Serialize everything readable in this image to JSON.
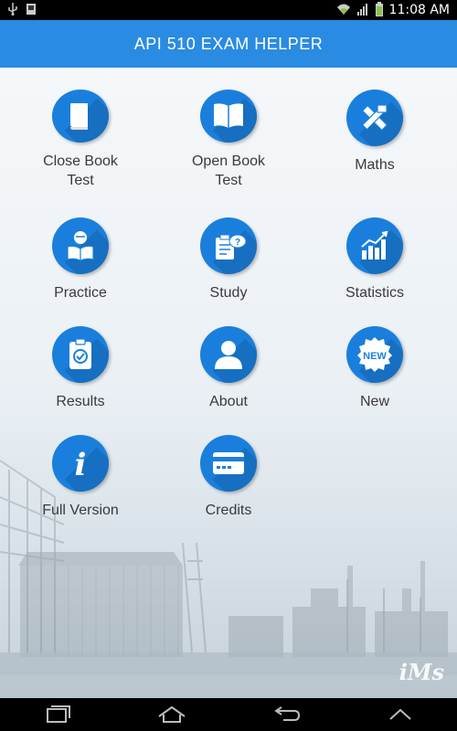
{
  "status_bar": {
    "time": "11:08 AM",
    "icons": [
      "usb-icon",
      "screenshot-icon",
      "wifi-icon",
      "signal-icon",
      "battery-icon"
    ]
  },
  "header": {
    "title": "API 510 EXAM HELPER"
  },
  "menu": {
    "items": [
      {
        "label": "Close Book\nTest",
        "icon": "closed-book-icon"
      },
      {
        "label": "Open Book\nTest",
        "icon": "open-book-icon"
      },
      {
        "label": "Maths",
        "icon": "pencil-ruler-icon"
      },
      {
        "label": "Practice",
        "icon": "reading-person-icon"
      },
      {
        "label": "Study",
        "icon": "study-clipboard-icon"
      },
      {
        "label": "Statistics",
        "icon": "bar-chart-icon"
      },
      {
        "label": "Results",
        "icon": "checklist-icon"
      },
      {
        "label": "About",
        "icon": "person-icon"
      },
      {
        "label": "New",
        "icon": "new-badge-icon"
      },
      {
        "label": "Full Version",
        "icon": "info-icon"
      },
      {
        "label": "Credits",
        "icon": "credit-card-icon"
      }
    ]
  },
  "new_badge_text": "NEW",
  "info_glyph": "i",
  "watermark": "iMs",
  "colors": {
    "header": "#2a8be2",
    "icon_circle": "#1a7fdc",
    "label": "#3a3a3a"
  }
}
